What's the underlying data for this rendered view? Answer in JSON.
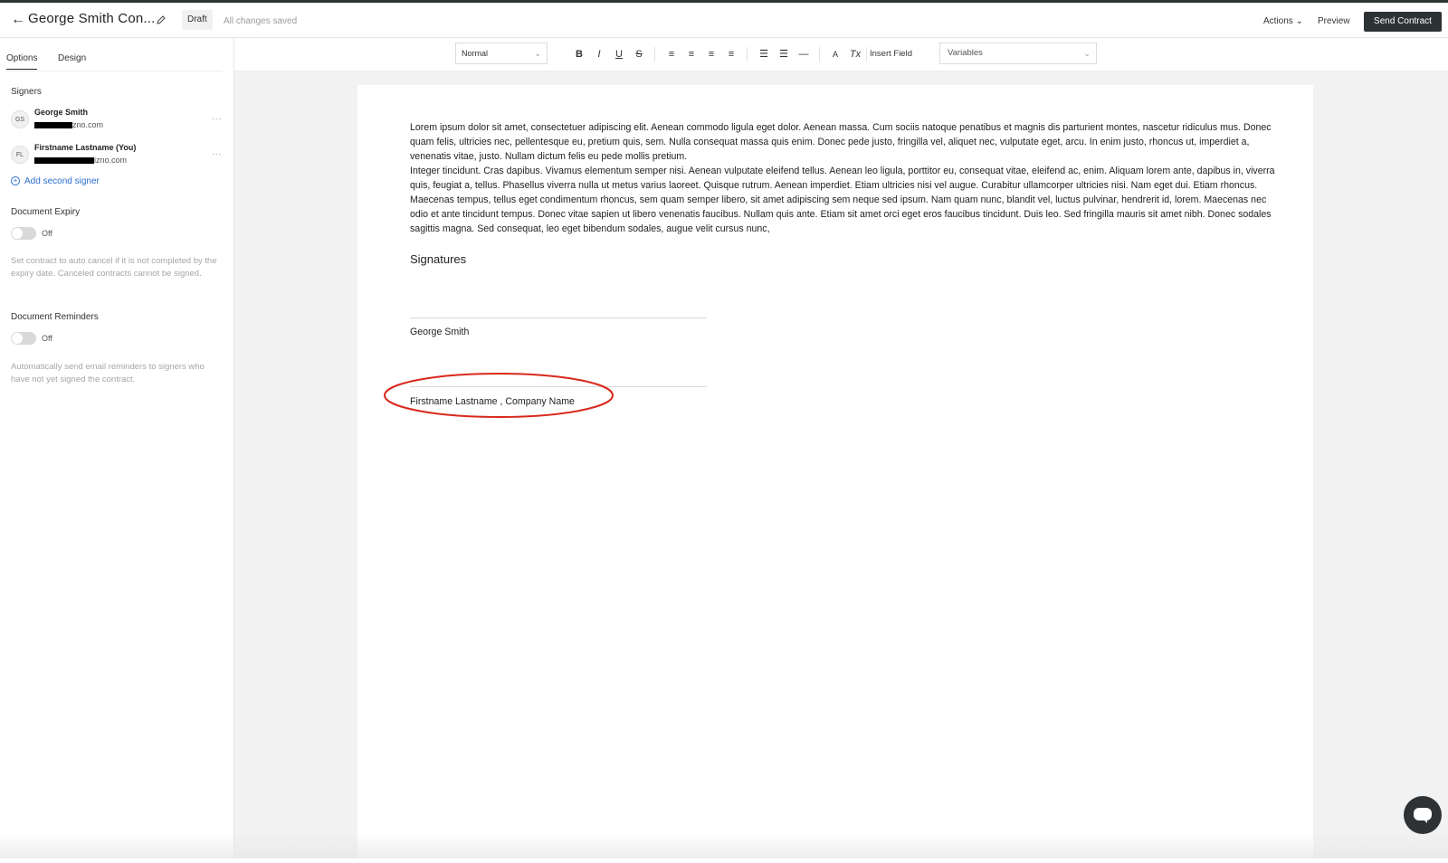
{
  "header": {
    "back_icon": "arrow-left-icon",
    "title": "George Smith Con...",
    "edit_icon": "pencil-icon",
    "status_badge": "Draft",
    "save_status": "All changes saved",
    "actions_label": "Actions",
    "preview_label": "Preview",
    "send_label": "Send Contract"
  },
  "sidebar": {
    "tabs": [
      {
        "label": "Options",
        "active": true
      },
      {
        "label": "Design",
        "active": false
      }
    ],
    "signers_label": "Signers",
    "signers": [
      {
        "initials": "GS",
        "name": "George Smith",
        "email_visible": "zno.com",
        "email_prefix_partial": "...."
      },
      {
        "initials": "FL",
        "name": "Firstname Lastname (You)",
        "email_visible": "izno.com"
      }
    ],
    "more_label": "...",
    "add_signer_label": "Add second signer",
    "expiry": {
      "label": "Document Expiry",
      "toggle_label": "Off",
      "help": "Set contract to auto cancel if it is not completed by the expiry date. Canceled contracts cannot be signed."
    },
    "reminders": {
      "label": "Document Reminders",
      "toggle_label": "Off",
      "help": "Automatically send email reminders to signers who have not yet signed the contract."
    }
  },
  "toolbar": {
    "style_value": "Normal",
    "buttons": [
      {
        "label": "B",
        "icon": "bold-icon"
      },
      {
        "label": "I",
        "icon": "italic-icon"
      },
      {
        "label": "U",
        "icon": "underline-icon"
      },
      {
        "label": "S",
        "icon": "strikethrough-icon"
      },
      {
        "label": "≡",
        "icon": "align-left-icon"
      },
      {
        "label": "≡",
        "icon": "align-center-icon"
      },
      {
        "label": "≡",
        "icon": "align-right-icon"
      },
      {
        "label": "≡",
        "icon": "align-justify-icon"
      },
      {
        "label": "☰",
        "icon": "bullet-list-icon"
      },
      {
        "label": "☰",
        "icon": "numbered-list-icon"
      },
      {
        "label": "—",
        "icon": "horizontal-rule-icon"
      },
      {
        "label": "A",
        "icon": "text-color-icon"
      },
      {
        "label": "Tx",
        "icon": "clear-format-icon"
      }
    ],
    "insert_field_label": "Insert Field",
    "variables_value": "Variables"
  },
  "document": {
    "paragraph1": "Lorem ipsum dolor sit amet, consectetuer adipiscing elit. Aenean commodo ligula eget dolor. Aenean massa. Cum sociis natoque penatibus et magnis dis parturient montes, nascetur ridiculus mus. Donec quam felis, ultricies nec, pellentesque eu, pretium quis, sem. Nulla consequat massa quis enim. Donec pede justo, fringilla vel, aliquet nec, vulputate eget, arcu. In enim justo, rhoncus ut, imperdiet a, venenatis vitae, justo. Nullam dictum felis eu pede mollis pretium.",
    "paragraph2": "Integer tincidunt. Cras dapibus. Vivamus elementum semper nisi. Aenean vulputate eleifend tellus. Aenean leo ligula, porttitor eu, consequat vitae, eleifend ac, enim. Aliquam lorem ante, dapibus in, viverra quis, feugiat a, tellus. Phasellus viverra nulla ut metus varius laoreet. Quisque rutrum. Aenean imperdiet. Etiam ultricies nisi vel augue. Curabitur ullamcorper ultricies nisi. Nam eget dui. Etiam rhoncus. Maecenas tempus, tellus eget condimentum rhoncus, sem quam semper libero, sit amet adipiscing sem neque sed ipsum. Nam quam nunc, blandit vel, luctus pulvinar, hendrerit id, lorem. Maecenas nec odio et ante tincidunt tempus. Donec vitae sapien ut libero venenatis faucibus. Nullam quis ante. Etiam sit amet orci eget eros faucibus tincidunt. Duis leo. Sed fringilla mauris sit amet nibh. Donec sodales sagittis magna. Sed consequat, leo eget bibendum sodales, augue velit cursus nunc,",
    "signatures_heading": "Signatures",
    "signature_names": [
      "George Smith",
      "Firstname Lastname , Company Name"
    ]
  },
  "annotation_color": "#d9281c",
  "accent_color": "#2d6ecf",
  "chat_icon": "chat-bubble-icon"
}
